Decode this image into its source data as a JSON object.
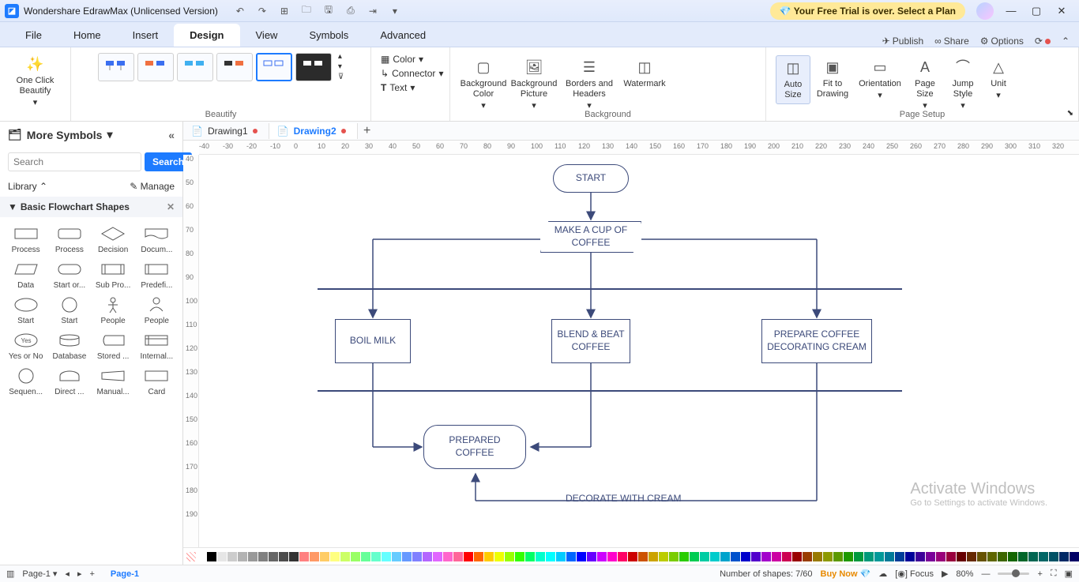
{
  "app": {
    "title": "Wondershare EdrawMax (Unlicensed Version)",
    "trial_banner": "Your Free Trial is over. Select a Plan"
  },
  "menu": {
    "tabs": [
      "File",
      "Home",
      "Insert",
      "Design",
      "View",
      "Symbols",
      "Advanced"
    ],
    "active": "Design",
    "right": {
      "publish": "Publish",
      "share": "Share",
      "options": "Options"
    }
  },
  "ribbon": {
    "one_click": "One Click\nBeautify",
    "beautify_label": "Beautify",
    "color": "Color",
    "connector": "Connector",
    "text": "Text",
    "bg_color": "Background\nColor",
    "bg_picture": "Background\nPicture",
    "borders_headers": "Borders and\nHeaders",
    "watermark": "Watermark",
    "background_label": "Background",
    "auto_size": "Auto\nSize",
    "fit_drawing": "Fit to\nDrawing",
    "orientation": "Orientation",
    "page_size": "Page\nSize",
    "jump_style": "Jump\nStyle",
    "unit": "Unit",
    "page_setup_label": "Page Setup"
  },
  "left": {
    "more_symbols": "More Symbols",
    "search_btn": "Search",
    "search_placeholder": "Search",
    "library": "Library",
    "manage": "Manage",
    "section": "Basic Flowchart Shapes",
    "shapes": [
      "Process",
      "Process",
      "Decision",
      "Docum...",
      "Data",
      "Start or...",
      "Sub Pro...",
      "Predefi...",
      "Start",
      "Start",
      "People",
      "People",
      "Yes or No",
      "Database",
      "Stored ...",
      "Internal...",
      "Sequen...",
      "Direct ...",
      "Manual...",
      "Card"
    ]
  },
  "docs": {
    "tabs": [
      {
        "name": "Drawing1",
        "active": false,
        "dirty": true
      },
      {
        "name": "Drawing2",
        "active": true,
        "dirty": true
      }
    ]
  },
  "ruler_h": [
    -40,
    -30,
    -20,
    -10,
    0,
    10,
    20,
    30,
    40,
    50,
    60,
    70,
    80,
    90,
    100,
    110,
    120,
    130,
    140,
    150,
    160,
    170,
    180,
    190,
    200,
    210,
    220,
    230,
    240,
    250,
    260,
    270,
    280,
    290,
    300,
    310,
    320
  ],
  "ruler_v": [
    40,
    50,
    60,
    70,
    80,
    90,
    100,
    110,
    120,
    130,
    140,
    150,
    160,
    170,
    180,
    190
  ],
  "flowchart": {
    "start": "START",
    "make_coffee": "MAKE A CUP OF COFFEE",
    "boil_milk": "BOIL MILK",
    "blend": "BLEND & BEAT COFFEE",
    "prepare_cream": "PREPARE COFFEE DECORATING CREAM",
    "prepared": "PREPARED COFFEE",
    "decorate_label": "DECORATE WITH CREAM"
  },
  "palette_colors": [
    "#fff",
    "#000",
    "#e6e6e6",
    "#cccccc",
    "#b3b3b3",
    "#999999",
    "#808080",
    "#666666",
    "#4d4d4d",
    "#333333",
    "#ff8080",
    "#ff9966",
    "#ffcc66",
    "#ffff80",
    "#ccff66",
    "#99ff66",
    "#66ff99",
    "#66ffcc",
    "#66ffff",
    "#66ccff",
    "#6699ff",
    "#8080ff",
    "#b366ff",
    "#e066ff",
    "#ff66cc",
    "#ff6699",
    "#ff0000",
    "#ff6600",
    "#ffcc00",
    "#eeff00",
    "#99ff00",
    "#33ff00",
    "#00ff66",
    "#00ffcc",
    "#00ffff",
    "#00ccff",
    "#0066ff",
    "#0000ff",
    "#6600ff",
    "#cc00ff",
    "#ff00cc",
    "#ff0066",
    "#cc0000",
    "#cc5200",
    "#cca300",
    "#bccc00",
    "#7acc00",
    "#29cc00",
    "#00cc52",
    "#00cca3",
    "#00cccc",
    "#00a3cc",
    "#0052cc",
    "#0000cc",
    "#5200cc",
    "#a300cc",
    "#cc00a3",
    "#cc0052",
    "#990000",
    "#993d00",
    "#997a00",
    "#8d9900",
    "#5c9900",
    "#1f9900",
    "#00993d",
    "#00997a",
    "#009999",
    "#007a99",
    "#003d99",
    "#000099",
    "#3d0099",
    "#7a0099",
    "#99007a",
    "#99003d",
    "#660000",
    "#662900",
    "#665200",
    "#5e6600",
    "#3d6600",
    "#146600",
    "#006629",
    "#006652",
    "#006666",
    "#005266",
    "#002966",
    "#000066",
    "#290066",
    "#520066",
    "#660052",
    "#660029"
  ],
  "status": {
    "page_tabs_left": "Page-1",
    "page_tab": "Page-1",
    "shapes": "Number of shapes: 7/60",
    "buy_now": "Buy Now",
    "focus": "Focus",
    "zoom": "80%"
  },
  "watermark": {
    "line1": "Activate Windows",
    "line2": "Go to Settings to activate Windows."
  },
  "chart_data": {
    "type": "flowchart",
    "nodes": [
      {
        "id": "start",
        "shape": "terminator",
        "text": "START"
      },
      {
        "id": "make",
        "shape": "parallelogram",
        "text": "MAKE A CUP OF COFFEE"
      },
      {
        "id": "boil",
        "shape": "process",
        "text": "BOIL MILK"
      },
      {
        "id": "blend",
        "shape": "process",
        "text": "BLEND & BEAT COFFEE"
      },
      {
        "id": "cream",
        "shape": "process",
        "text": "PREPARE COFFEE DECORATING CREAM"
      },
      {
        "id": "prepared",
        "shape": "terminator",
        "text": "PREPARED COFFEE"
      }
    ],
    "edges": [
      {
        "from": "start",
        "to": "make"
      },
      {
        "from": "make",
        "to": "boil"
      },
      {
        "from": "make",
        "to": "blend"
      },
      {
        "from": "make",
        "to": "cream"
      },
      {
        "from": "boil",
        "to": "prepared"
      },
      {
        "from": "blend",
        "to": "prepared"
      },
      {
        "from": "cream",
        "to": "prepared",
        "label": "DECORATE WITH CREAM"
      }
    ],
    "swimlane_lines": [
      170,
      299
    ]
  }
}
